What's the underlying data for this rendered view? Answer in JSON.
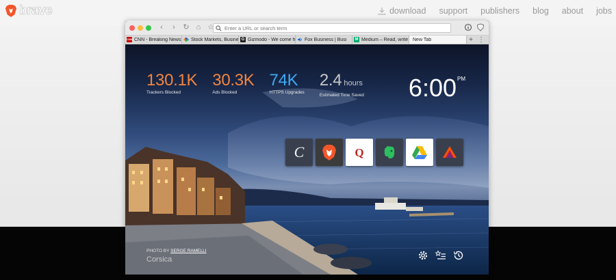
{
  "site": {
    "brand_text": "brave",
    "nav": [
      {
        "label": "download"
      },
      {
        "label": "support"
      },
      {
        "label": "publishers"
      },
      {
        "label": "blog"
      },
      {
        "label": "about"
      },
      {
        "label": "jobs"
      }
    ]
  },
  "browser": {
    "url_placeholder": "Enter a URL or search term",
    "tabs": [
      {
        "title": "CNN - Breaking News,",
        "favicon": "cnn-icon",
        "color": "#cc0000",
        "glyph": "CNN"
      },
      {
        "title": "Stock Markets, Busine",
        "favicon": "cnbc-peacock-icon",
        "color": "#f28b24",
        "glyph": ""
      },
      {
        "title": "Gizmodo - We come fr",
        "favicon": "gizmodo-icon",
        "color": "#222222",
        "glyph": "G"
      },
      {
        "title": "Fox Business | Busi",
        "favicon": "speaker-icon",
        "color": "#1d6fd6",
        "glyph": ""
      },
      {
        "title": "Medium – Read, write",
        "favicon": "medium-icon",
        "color": "#00ab6c",
        "glyph": "M"
      },
      {
        "title": "New Tab",
        "favicon": "",
        "color": "",
        "glyph": ""
      }
    ]
  },
  "new_tab": {
    "stats": [
      {
        "value": "130.1K",
        "unit": "",
        "label": "Trackers Blocked",
        "color": "#f4853f"
      },
      {
        "value": "30.3K",
        "unit": "",
        "label": "Ads Blocked",
        "color": "#f4853f"
      },
      {
        "value": "74K",
        "unit": "",
        "label": "HTTPS Upgrades",
        "color": "#3fa9f5"
      },
      {
        "value": "2.4",
        "unit": " hours",
        "label": "Estimated Time Saved",
        "color": "#c8c8c8"
      }
    ],
    "clock": {
      "time": "6:00",
      "period": "PM"
    },
    "top_sites": [
      {
        "name": "the-atlantic-tile",
        "bg": "#3a3f4d"
      },
      {
        "name": "brave-tile",
        "bg": "#3b3b3b"
      },
      {
        "name": "quora-tile",
        "bg": "#ffffff"
      },
      {
        "name": "evernote-tile",
        "bg": "#3a3f4d"
      },
      {
        "name": "google-drive-tile",
        "bg": "#ffffff"
      },
      {
        "name": "brave-bat-tile",
        "bg": "#3a3f4d"
      }
    ],
    "photo_by_prefix": "PHOTO BY ",
    "photo_by_name": "SERGE RAMELLI",
    "location": "Corsica"
  }
}
